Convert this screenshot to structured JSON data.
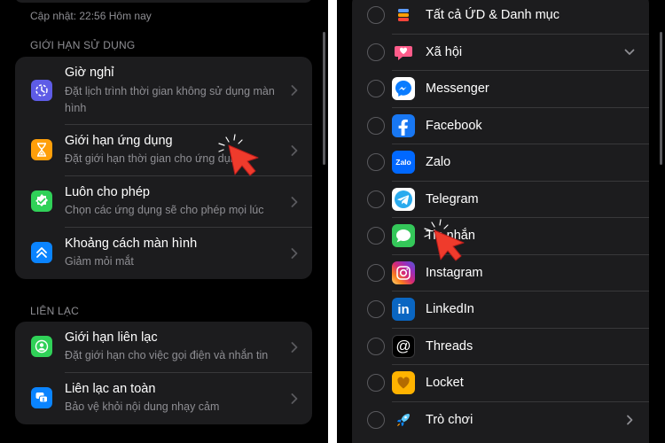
{
  "left": {
    "updated_text": "Cập nhật: 22:56 Hôm nay",
    "usage_header": "GIỚI HẠN SỬ DỤNG",
    "usage_items": [
      {
        "title": "Giờ nghỉ",
        "subtitle": "Đặt lịch trình thời gian không sử dụng màn hình",
        "icon": "downtime-icon",
        "color": "#5e5ce6"
      },
      {
        "title": "Giới hạn ứng dụng",
        "subtitle": "Đặt giới hạn thời gian cho ứng dụng",
        "icon": "hourglass-icon",
        "color": "#ff9f0a"
      },
      {
        "title": "Luôn cho phép",
        "subtitle": "Chọn các ứng dụng sẽ cho phép mọi lúc",
        "icon": "checkmark-badge-icon",
        "color": "#30d158"
      },
      {
        "title": "Khoảng cách màn hình",
        "subtitle": "Giảm mỏi mắt",
        "icon": "chevrons-up-icon",
        "color": "#0a84ff"
      }
    ],
    "communication_header": "LIÊN LẠC",
    "communication_items": [
      {
        "title": "Giới hạn liên lạc",
        "subtitle": "Đặt giới hạn cho việc gọi điện và nhắn tin",
        "icon": "person-circle-icon",
        "color": "#30d158"
      },
      {
        "title": "Liên lạc an toàn",
        "subtitle": "Bảo vệ khỏi nội dung nhạy cảm",
        "icon": "chat-bubble-icon",
        "color": "#0a84ff"
      }
    ]
  },
  "right": {
    "apps": [
      {
        "label": "Tất cả ỨD & Danh mục",
        "icon": "layers-stack-icon",
        "has_chevron": false
      },
      {
        "label": "Xã hội",
        "icon": "social-heart-bubble-icon",
        "has_chevron": true,
        "chevron": "down"
      },
      {
        "label": "Messenger",
        "icon": "messenger-icon",
        "has_chevron": false
      },
      {
        "label": "Facebook",
        "icon": "facebook-icon",
        "has_chevron": false
      },
      {
        "label": "Zalo",
        "icon": "zalo-icon",
        "icon_text": "Zalo",
        "has_chevron": false
      },
      {
        "label": "Telegram",
        "icon": "telegram-icon",
        "has_chevron": false
      },
      {
        "label": "Tin nhắn",
        "icon": "messages-icon",
        "has_chevron": false
      },
      {
        "label": "Instagram",
        "icon": "instagram-icon",
        "has_chevron": false
      },
      {
        "label": "LinkedIn",
        "icon": "linkedin-icon",
        "icon_text": "in",
        "has_chevron": false
      },
      {
        "label": "Threads",
        "icon": "threads-icon",
        "icon_text": "@",
        "has_chevron": false
      },
      {
        "label": "Locket",
        "icon": "locket-icon",
        "has_chevron": false
      },
      {
        "label": "Trò chơi",
        "icon": "rocket-icon",
        "has_chevron": true,
        "chevron": "right"
      }
    ]
  },
  "colors": {
    "background": "#000000",
    "card": "#1c1c1e",
    "secondary_text": "#8e8e93",
    "cursor": "#ff3b30"
  }
}
